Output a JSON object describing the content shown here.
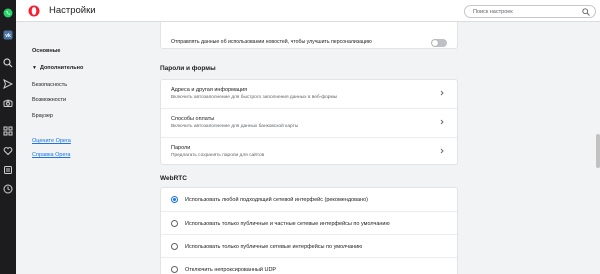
{
  "app": {
    "title": "Настройки",
    "accent": "#1a73e8",
    "brand_color": "#ff1b2d"
  },
  "search": {
    "placeholder": "Поиск настроек",
    "value": ""
  },
  "opera_sidebar": {
    "icons": [
      "whatsapp-icon",
      "vk-icon",
      "home-icon",
      "search-icon",
      "send-icon",
      "camera-icon",
      "grid-icon",
      "heart-icon",
      "history-icon",
      "clock-icon"
    ]
  },
  "nav": {
    "basic": "Основные",
    "advanced": "Дополнительно",
    "security": "Безопасность",
    "features": "Возможности",
    "browser": "Браузер",
    "rate": "Оцените Opera",
    "help": "Справка Opera"
  },
  "news_row": {
    "label": "Отправлять данные об использовании новостей, чтобы улучшить персонализацию",
    "enabled": false
  },
  "passwords_section": {
    "title": "Пароли и формы",
    "rows": [
      {
        "title": "Адреса и другая информация",
        "subtitle": "Включить автозаполнение для быстрого заполнения данных в веб-формы"
      },
      {
        "title": "Способы оплаты",
        "subtitle": "Включить автозаполнение для данных банковской карты"
      },
      {
        "title": "Пароли",
        "subtitle": "Предлагать сохранять пароли для сайтов"
      }
    ]
  },
  "webrtc_section": {
    "title": "WebRTC",
    "options": [
      {
        "label": "Использовать любой подходящий сетевой интерфейс (рекомендовано)",
        "checked": true
      },
      {
        "label": "Использовать только публичные и частные сетевые интерфейсы по умолчанию",
        "checked": false
      },
      {
        "label": "Использовать только публичные сетевые интерфейсы по умолчанию",
        "checked": false
      },
      {
        "label": "Отключить непроксированный UDP",
        "checked": false
      }
    ]
  }
}
